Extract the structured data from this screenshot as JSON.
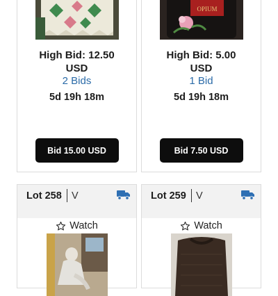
{
  "cards_top": [
    {
      "high_bid": "High Bid: 12.50",
      "currency": "USD",
      "bids": "2 Bids",
      "time_left": "5d 19h 18m",
      "button": "Bid 15.00 USD"
    },
    {
      "high_bid": "High Bid: 5.00",
      "currency": "USD",
      "bids": "1 Bid",
      "time_left": "5d 19h 18m",
      "button": "Bid 7.50 USD"
    }
  ],
  "cards_bottom": [
    {
      "lot": "Lot 258",
      "tag": "V",
      "watch": "Watch"
    },
    {
      "lot": "Lot 259",
      "tag": "V",
      "watch": "Watch"
    }
  ],
  "image_text": {
    "perfume_label": "OPIUM"
  },
  "colors": {
    "accent_blue": "#2b6ba8",
    "button_bg": "#0d0d0d",
    "truck_blue": "#2e6fb3"
  },
  "icons": {
    "shipping": "truck-icon",
    "watch": "star-outline-icon"
  }
}
